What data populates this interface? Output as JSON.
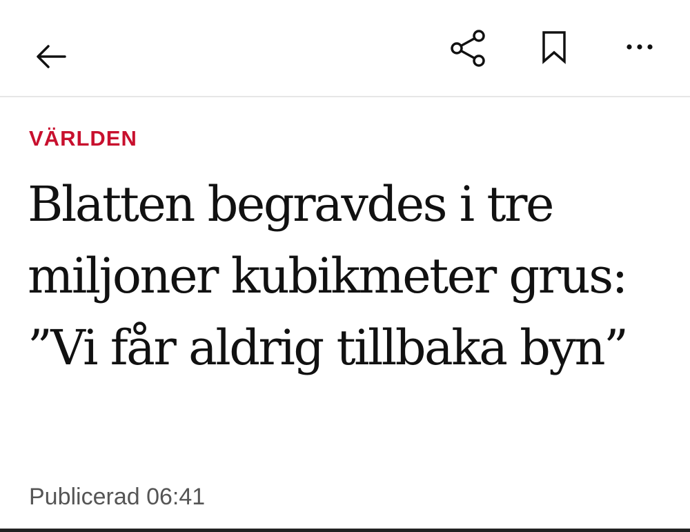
{
  "toolbar": {
    "icons": [
      "arrow-left-icon",
      "share-icon",
      "bookmark-icon",
      "more-horizontal-icon"
    ]
  },
  "article": {
    "section": "VÄRLDEN",
    "headline": "Blatten begravdes i tre miljoner kubikmeter grus: ”Vi får aldrig tillbaka byn”",
    "published": "Publicerad 06:41"
  },
  "colors": {
    "section_red": "#c8102e",
    "text": "#111111",
    "meta_gray": "#555555",
    "divider": "#e6e6e6"
  }
}
